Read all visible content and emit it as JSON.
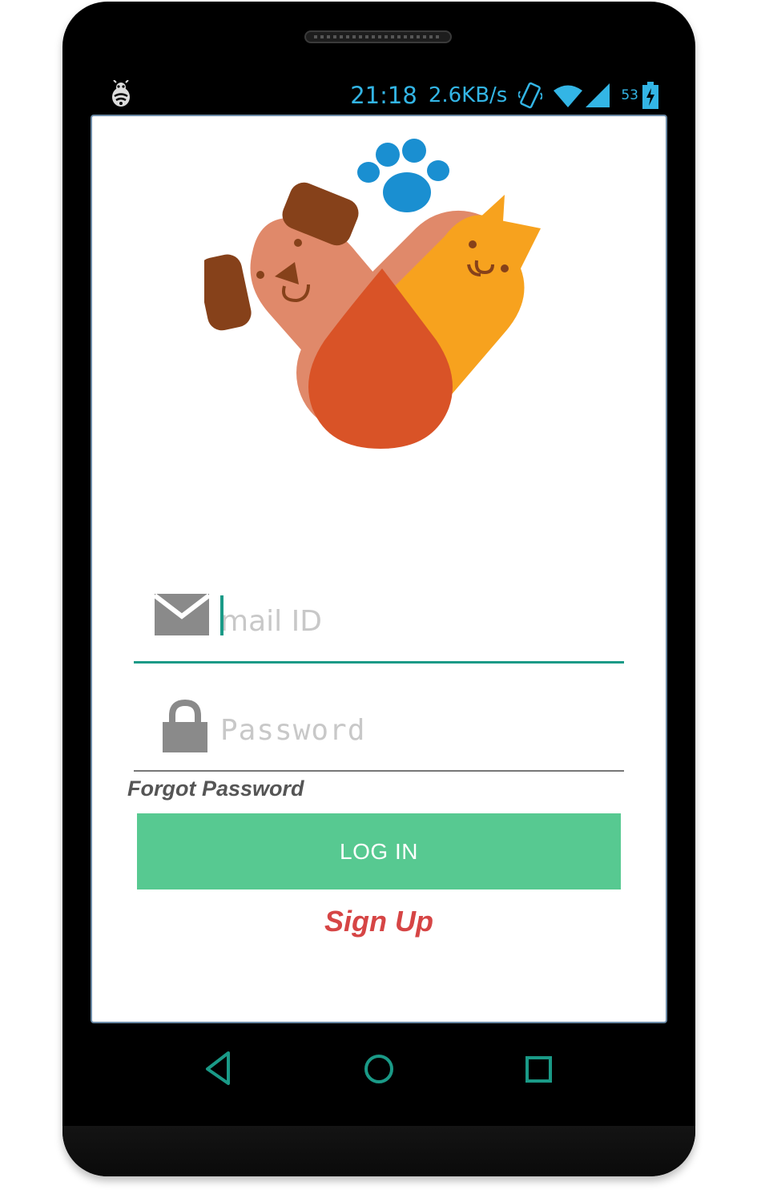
{
  "status_bar": {
    "time": "21:18",
    "network_speed": "2.6KB/s",
    "battery_level": "53",
    "icons": [
      "bug-icon",
      "vibrate-icon",
      "wifi-icon",
      "signal-icon",
      "battery-charging-icon"
    ]
  },
  "login_form": {
    "email_placeholder": "mail ID",
    "password_placeholder": "Password",
    "forgot_password_label": "Forgot Password",
    "login_button_label": "LOG IN",
    "signup_label": "Sign Up"
  },
  "navigation": {
    "icons": [
      "back-icon",
      "home-icon",
      "recents-icon"
    ]
  },
  "colors": {
    "accent": "#1a9a87",
    "button": "#57c991",
    "signup": "#d64545",
    "status": "#33b5e5",
    "paw": "#1a8fd1",
    "dog": "#e0896a",
    "cat": "#f7a21e",
    "heart_center": "#d95327",
    "ears": "#86411a"
  }
}
